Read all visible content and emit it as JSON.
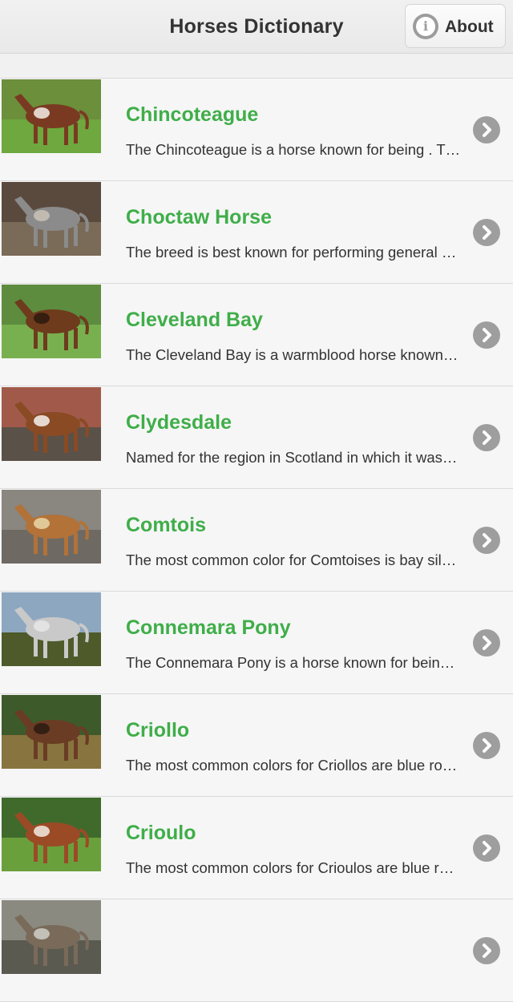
{
  "header": {
    "title": "Horses Dictionary",
    "about_label": "About"
  },
  "icons": {
    "about": "info-icon",
    "row_action": "chevron-right-icon"
  },
  "colors": {
    "title_green": "#3fae49",
    "chevron_gray": "#9e9e9e"
  },
  "items": [
    {
      "title": "Chincoteague",
      "desc": "The Chincoteague is a horse known for being . T…",
      "coat": "#7a3a22",
      "sky": "#6b8f3a",
      "ground": "#6ea83e",
      "patch": "#f3efe6"
    },
    {
      "title": "Choctaw Horse",
      "desc": "The breed is best known for performing general r…",
      "coat": "#8b8b8b",
      "sky": "#5a4a3e",
      "ground": "#7a6a58",
      "patch": "#c9c2b6"
    },
    {
      "title": "Cleveland Bay",
      "desc": "The Cleveland Bay is a warmblood horse known…",
      "coat": "#6e3b1d",
      "sky": "#5d8c3f",
      "ground": "#79b04f",
      "patch": "#2d1a0e"
    },
    {
      "title": "Clydesdale",
      "desc": "Named for the region in Scotland in which it was …",
      "coat": "#8a4a24",
      "sky": "#a15a4a",
      "ground": "#5a5148",
      "patch": "#f4f1ec"
    },
    {
      "title": "Comtois",
      "desc": "The most common color for Comtoises is bay sil…",
      "coat": "#b27238",
      "sky": "#8a8680",
      "ground": "#6e6a63",
      "patch": "#e9d7a8"
    },
    {
      "title": "Connemara Pony",
      "desc": "The Connemara Pony is a horse known for bein…",
      "coat": "#c9c9c9",
      "sky": "#8ea7c0",
      "ground": "#4e5a2a",
      "patch": "#e7e7e7"
    },
    {
      "title": "Criollo",
      "desc": "The most common colors for Criollos are blue ro…",
      "coat": "#6a3c24",
      "sky": "#3d5a2a",
      "ground": "#88743f",
      "patch": "#2a1a10"
    },
    {
      "title": "Crioulo",
      "desc": "The most common colors for Crioulos are blue r…",
      "coat": "#9b4a26",
      "sky": "#3f6a2c",
      "ground": "#6aa03c",
      "patch": "#f2ece2"
    },
    {
      "title": "",
      "desc": "",
      "coat": "#7a6a5a",
      "sky": "#8a8a80",
      "ground": "#5a5a50",
      "patch": "#cfcfc8"
    }
  ]
}
